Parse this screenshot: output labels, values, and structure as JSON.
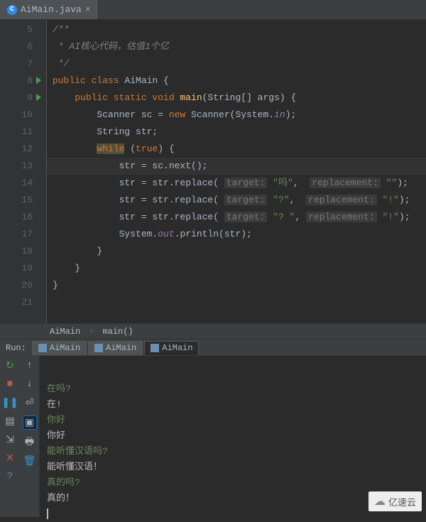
{
  "tab": {
    "filename": "AiMain.java",
    "icon_letter": "C"
  },
  "gutter": {
    "start": 5,
    "end": 21,
    "run_markers": [
      8,
      9
    ]
  },
  "code_lines": [
    {
      "n": 5,
      "segs": [
        {
          "t": "/**",
          "c": "cm"
        }
      ]
    },
    {
      "n": 6,
      "segs": [
        {
          "t": " * AI核心代码，估值1个亿",
          "c": "cm"
        }
      ]
    },
    {
      "n": 7,
      "segs": [
        {
          "t": " */",
          "c": "cm"
        }
      ]
    },
    {
      "n": 8,
      "segs": [
        {
          "t": "public class ",
          "c": "kw"
        },
        {
          "t": "AiMain {",
          "c": "pn"
        }
      ]
    },
    {
      "n": 9,
      "segs": [
        {
          "t": "    ",
          "c": ""
        },
        {
          "t": "public static void ",
          "c": "kw"
        },
        {
          "t": "main",
          "c": "fn"
        },
        {
          "t": "(String[] args) {",
          "c": "pn"
        }
      ]
    },
    {
      "n": 10,
      "segs": [
        {
          "t": "        Scanner sc = ",
          "c": "pn"
        },
        {
          "t": "new ",
          "c": "kw"
        },
        {
          "t": "Scanner(System.",
          "c": "pn"
        },
        {
          "t": "in",
          "c": "st"
        },
        {
          "t": ");",
          "c": "pn"
        }
      ]
    },
    {
      "n": 11,
      "segs": [
        {
          "t": "        String str;",
          "c": "pn"
        }
      ]
    },
    {
      "n": 12,
      "segs": [
        {
          "t": "        ",
          "c": ""
        },
        {
          "t": "while",
          "c": "kw warn"
        },
        {
          "t": " (",
          "c": "pn"
        },
        {
          "t": "true",
          "c": "kw"
        },
        {
          "t": ") {",
          "c": "pn"
        }
      ]
    },
    {
      "n": 13,
      "hl": true,
      "segs": [
        {
          "t": "            str = sc.next();",
          "c": "pn"
        }
      ]
    },
    {
      "n": 14,
      "segs": [
        {
          "t": "            str = str.replace( ",
          "c": "pn"
        },
        {
          "t": "target:",
          "c": "hint"
        },
        {
          "t": " ",
          "c": ""
        },
        {
          "t": "\"吗\"",
          "c": "str"
        },
        {
          "t": ",  ",
          "c": "pn"
        },
        {
          "t": "replacement:",
          "c": "hint"
        },
        {
          "t": " ",
          "c": ""
        },
        {
          "t": "\"\"",
          "c": "str"
        },
        {
          "t": ");",
          "c": "pn"
        }
      ]
    },
    {
      "n": 15,
      "segs": [
        {
          "t": "            str = str.replace( ",
          "c": "pn"
        },
        {
          "t": "target:",
          "c": "hint"
        },
        {
          "t": " ",
          "c": ""
        },
        {
          "t": "\"?\"",
          "c": "str"
        },
        {
          "t": ",  ",
          "c": "pn"
        },
        {
          "t": "replacement:",
          "c": "hint"
        },
        {
          "t": " ",
          "c": ""
        },
        {
          "t": "\"!\"",
          "c": "str"
        },
        {
          "t": ");",
          "c": "pn"
        }
      ]
    },
    {
      "n": 16,
      "segs": [
        {
          "t": "            str = str.replace( ",
          "c": "pn"
        },
        {
          "t": "target:",
          "c": "hint"
        },
        {
          "t": " ",
          "c": ""
        },
        {
          "t": "\"? \"",
          "c": "str"
        },
        {
          "t": ", ",
          "c": "pn"
        },
        {
          "t": "replacement:",
          "c": "hint"
        },
        {
          "t": " ",
          "c": ""
        },
        {
          "t": "\"!\"",
          "c": "str"
        },
        {
          "t": ");",
          "c": "pn"
        }
      ]
    },
    {
      "n": 17,
      "segs": [
        {
          "t": "            System.",
          "c": "pn"
        },
        {
          "t": "out",
          "c": "st"
        },
        {
          "t": ".println(str);",
          "c": "pn"
        }
      ]
    },
    {
      "n": 18,
      "segs": [
        {
          "t": "        }",
          "c": "pn"
        }
      ]
    },
    {
      "n": 19,
      "segs": [
        {
          "t": "    }",
          "c": "pn"
        }
      ]
    },
    {
      "n": 20,
      "segs": [
        {
          "t": "}",
          "c": "pn"
        }
      ]
    },
    {
      "n": 21,
      "segs": [
        {
          "t": "",
          "c": ""
        }
      ]
    }
  ],
  "breadcrumb": {
    "class": "AiMain",
    "method": "main()"
  },
  "run": {
    "label": "Run:",
    "tabs": [
      "AiMain",
      "AiMain",
      "AiMain"
    ],
    "active": 2
  },
  "console_lines": [
    {
      "t": "在吗?",
      "k": "in"
    },
    {
      "t": "在!",
      "k": "out"
    },
    {
      "t": "你好",
      "k": "in"
    },
    {
      "t": "你好",
      "k": "out"
    },
    {
      "t": "能听懂汉语吗?",
      "k": "in"
    },
    {
      "t": "能听懂汉语！",
      "k": "out"
    },
    {
      "t": "真的吗?",
      "k": "in"
    },
    {
      "t": "真的！",
      "k": "out"
    }
  ],
  "watermark": "亿速云"
}
